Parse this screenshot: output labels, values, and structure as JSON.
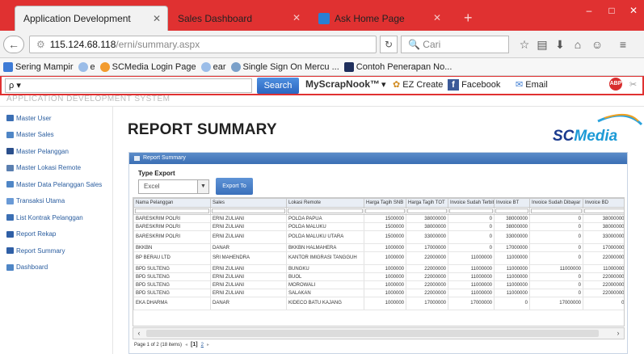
{
  "browser": {
    "tabs": [
      {
        "label": "Application Development",
        "active": true
      },
      {
        "label": "Sales Dashboard",
        "active": false
      },
      {
        "label": "Ask Home Page",
        "active": false
      }
    ],
    "new_tab": "+",
    "url_host": "115.124.68.118",
    "url_path": "/erni/summary.aspx",
    "search_placeholder": "Cari",
    "window_buttons": [
      "–",
      "□",
      "✕"
    ]
  },
  "bookmarks": [
    "Sering Mampir",
    "e",
    "SCMedia Login Page",
    "ear",
    "Single Sign On Mercu ...",
    "Contoh Penerapan No..."
  ],
  "toolbar2": {
    "search_button": "Search",
    "brand": "MyScrapNook™",
    "items": [
      "EZ Create",
      "Facebook",
      "Email"
    ]
  },
  "app": {
    "title": "APPLICATION DEVELOPMENT SYSTEM",
    "sidebar": [
      {
        "label": "Master User",
        "color": "#3b6fb4"
      },
      {
        "label": "Master Sales",
        "color": "#4f86c6"
      },
      {
        "label": "Master Pelanggan",
        "color": "#2b4f8c"
      },
      {
        "label": "Master Lokasi Remote",
        "color": "#5a7fb0"
      },
      {
        "label": "Master Data Pelanggan Sales",
        "color": "#4f86c6"
      },
      {
        "label": "Transaksi Utama",
        "color": "#6a9ad6"
      },
      {
        "label": "List Kontrak Pelanggan",
        "color": "#3b6fb4"
      },
      {
        "label": "Report Rekap",
        "color": "#2f5fa6"
      },
      {
        "label": "Report Summary",
        "color": "#2f5fa6"
      },
      {
        "label": "Dashboard",
        "color": "#4f86c6"
      }
    ],
    "page_title": "REPORT SUMMARY",
    "logo_sc": "SC",
    "logo_media": "Media"
  },
  "panel": {
    "title": "Report Summary",
    "type_label": "Type Export",
    "type_value": "Excel",
    "export_button": "Export To"
  },
  "table": {
    "columns": [
      "Nama Pelanggan",
      "Sales",
      "Lokasi Remote",
      "Harga Tagih SNB",
      "Harga Tagih TOT",
      "Invoice Sudah Terbit",
      "Invoice BT",
      "Invoice Sudah Dibayar",
      "Invoice BD"
    ],
    "rows": [
      [
        "BARESKRIM POLRI",
        "ERNI ZULIANI",
        "POLDA PAPUA",
        "1500000",
        "38000000",
        "0",
        "38000000",
        "0",
        "38000000"
      ],
      [
        "BARESKRIM POLRI",
        "ERNI ZULIANI",
        "POLDA MALUKU",
        "1500000",
        "38000000",
        "0",
        "38000000",
        "0",
        "38000000"
      ],
      [
        "BARESKRIM POLRI",
        "ERNI ZULIANI",
        "POLDA MALUKU UTARA",
        "1500000",
        "33000000",
        "0",
        "33000000",
        "0",
        "33000000"
      ],
      [
        "BKKBN",
        "DANAR",
        "BKKBN HALMAHERA",
        "1000000",
        "17000000",
        "0",
        "17000000",
        "0",
        "17000000"
      ],
      [
        "BP BERAU LTD",
        "SRI MAHENDRA",
        "KANTOR IMIGRASI TANGGUH",
        "1000000",
        "22000000",
        "11000000",
        "11000000",
        "0",
        "22000000"
      ],
      [
        "BPD SULTENG",
        "ERNI ZULIANI",
        "BUNGKU",
        "1000000",
        "22000000",
        "11000000",
        "11000000",
        "11000000",
        "11000000"
      ],
      [
        "BPD SULTENG",
        "ERNI ZULIANI",
        "BUOL",
        "1000000",
        "22000000",
        "11000000",
        "11000000",
        "0",
        "22000000"
      ],
      [
        "BPD SULTENG",
        "ERNI ZULIANI",
        "MOROWALI",
        "1000000",
        "22000000",
        "11000000",
        "11000000",
        "0",
        "22000000"
      ],
      [
        "BPD SULTENG",
        "ERNI ZULIANI",
        "SALAKAN",
        "1000000",
        "22000000",
        "11000000",
        "11000000",
        "0",
        "22000000"
      ],
      [
        "EKA DHARMA",
        "DANAR",
        "KIDECO BATU KAJANG",
        "1000000",
        "17000000",
        "17000000",
        "0",
        "17000000",
        "0"
      ]
    ]
  },
  "pager": {
    "info": "Page 1 of 2 (18 items)",
    "current": "[1]",
    "next": "2"
  }
}
